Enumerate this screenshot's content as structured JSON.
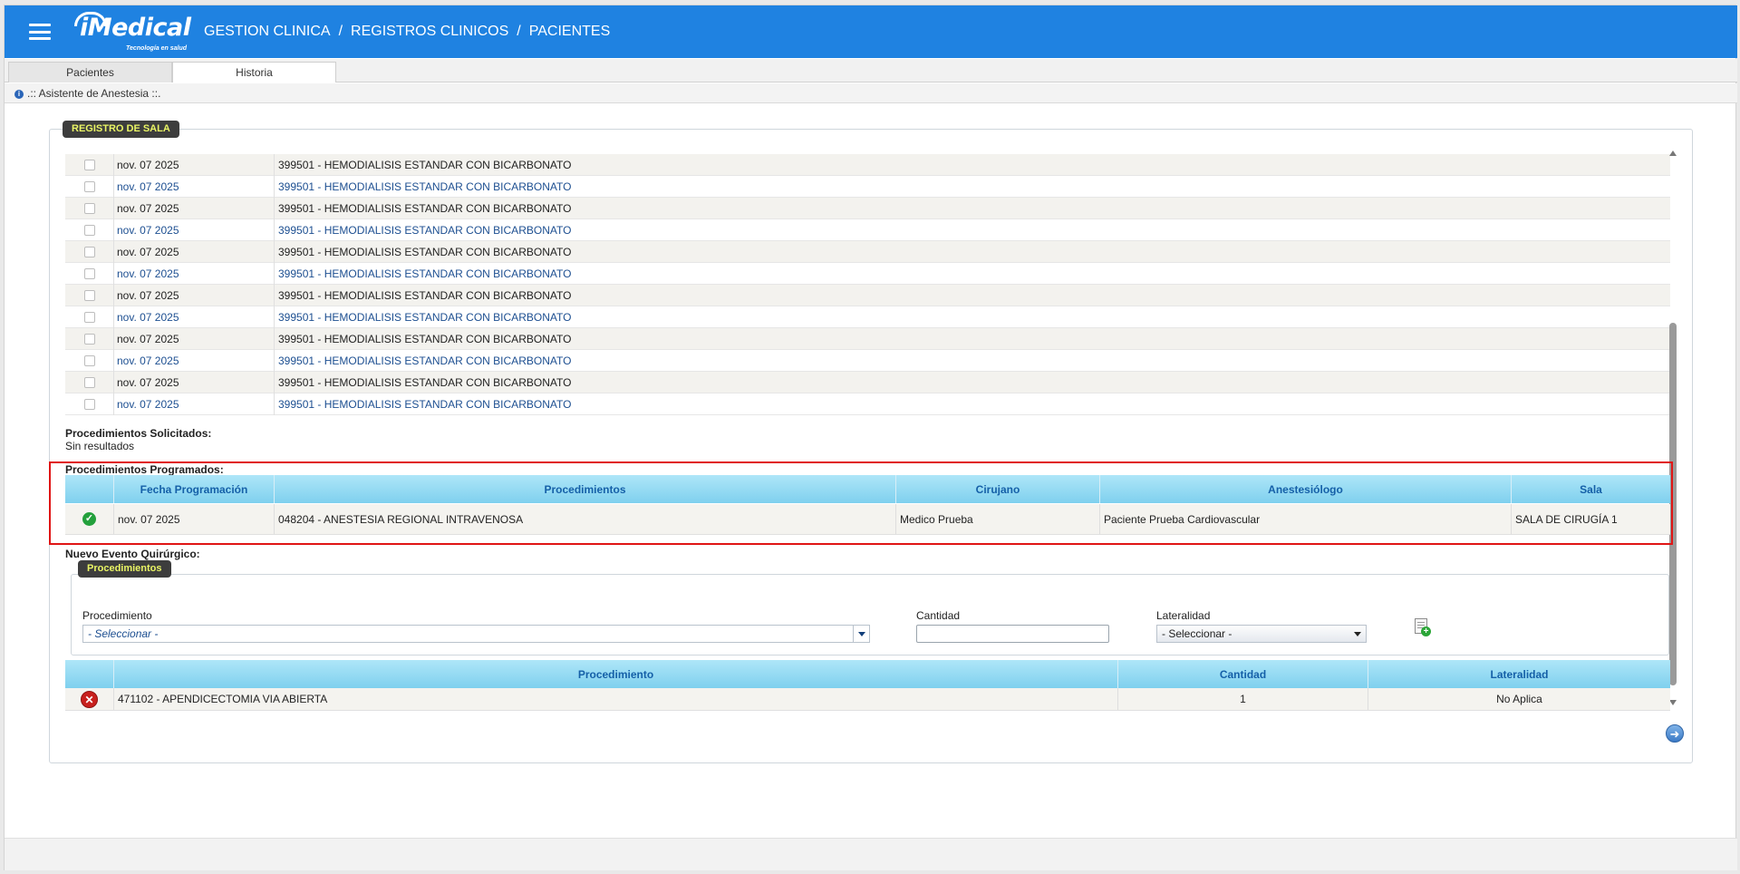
{
  "header": {
    "logo_text": "iMedical",
    "logo_subtitle": "Tecnología en salud",
    "breadcrumb": [
      "GESTION CLINICA",
      "/",
      "REGISTROS CLINICOS",
      "/",
      "PACIENTES"
    ]
  },
  "tabs": [
    {
      "label": "Pacientes"
    },
    {
      "label": "Historia"
    }
  ],
  "assistant_label": ".:: Asistente de Anestesia ::.",
  "section_title": "REGISTRO DE SALA",
  "rows": [
    {
      "date": "nov. 07 2025",
      "procedure": "399501 - HEMODIALISIS ESTANDAR CON BICARBONATO"
    },
    {
      "date": "nov. 07 2025",
      "procedure": "399501 - HEMODIALISIS ESTANDAR CON BICARBONATO"
    },
    {
      "date": "nov. 07 2025",
      "procedure": "399501 - HEMODIALISIS ESTANDAR CON BICARBONATO"
    },
    {
      "date": "nov. 07 2025",
      "procedure": "399501 - HEMODIALISIS ESTANDAR CON BICARBONATO"
    },
    {
      "date": "nov. 07 2025",
      "procedure": "399501 - HEMODIALISIS ESTANDAR CON BICARBONATO"
    },
    {
      "date": "nov. 07 2025",
      "procedure": "399501 - HEMODIALISIS ESTANDAR CON BICARBONATO"
    },
    {
      "date": "nov. 07 2025",
      "procedure": "399501 - HEMODIALISIS ESTANDAR CON BICARBONATO"
    },
    {
      "date": "nov. 07 2025",
      "procedure": "399501 - HEMODIALISIS ESTANDAR CON BICARBONATO"
    },
    {
      "date": "nov. 07 2025",
      "procedure": "399501 - HEMODIALISIS ESTANDAR CON BICARBONATO"
    },
    {
      "date": "nov. 07 2025",
      "procedure": "399501 - HEMODIALISIS ESTANDAR CON BICARBONATO"
    },
    {
      "date": "nov. 07 2025",
      "procedure": "399501 - HEMODIALISIS ESTANDAR CON BICARBONATO"
    },
    {
      "date": "nov. 07 2025",
      "procedure": "399501 - HEMODIALISIS ESTANDAR CON BICARBONATO"
    }
  ],
  "solicitados": {
    "label": "Procedimientos Solicitados:",
    "empty_text": "Sin resultados"
  },
  "programados": {
    "label": "Procedimientos Programados:",
    "columns": [
      "Fecha Programación",
      "Procedimientos",
      "Cirujano",
      "Anestesiólogo",
      "Sala"
    ],
    "row": {
      "status_icon": "check-circle-icon",
      "date": "nov. 07 2025",
      "procedure": "048204 - ANESTESIA REGIONAL INTRAVENOSA",
      "surgeon": "Medico Prueba",
      "anesthesiologist": "Paciente Prueba Cardiovascular",
      "room": "SALA DE CIRUGÍA 1"
    }
  },
  "nuevo_evento": {
    "label": "Nuevo Evento Quirúrgico:",
    "legend": "Procedimientos",
    "procedimiento_label": "Procedimiento",
    "procedimiento_value": "- Seleccionar -",
    "cantidad_label": "Cantidad",
    "cantidad_value": "",
    "lateralidad_label": "Lateralidad",
    "lateralidad_value": "- Seleccionar -"
  },
  "added": {
    "columns": [
      "Procedimiento",
      "Cantidad",
      "Lateralidad"
    ],
    "row": {
      "procedure": "471102 - APENDICECTOMIA VIA ABIERTA",
      "quantity": "1",
      "laterality": "No Aplica"
    }
  },
  "colors": {
    "topbar": "#1f82e1",
    "header_gradient_top": "#aee6f8",
    "header_text": "#1560a8",
    "highlight_box": "#e01515",
    "legend_bg": "#3d3d3d",
    "legend_text": "#eaf565"
  }
}
